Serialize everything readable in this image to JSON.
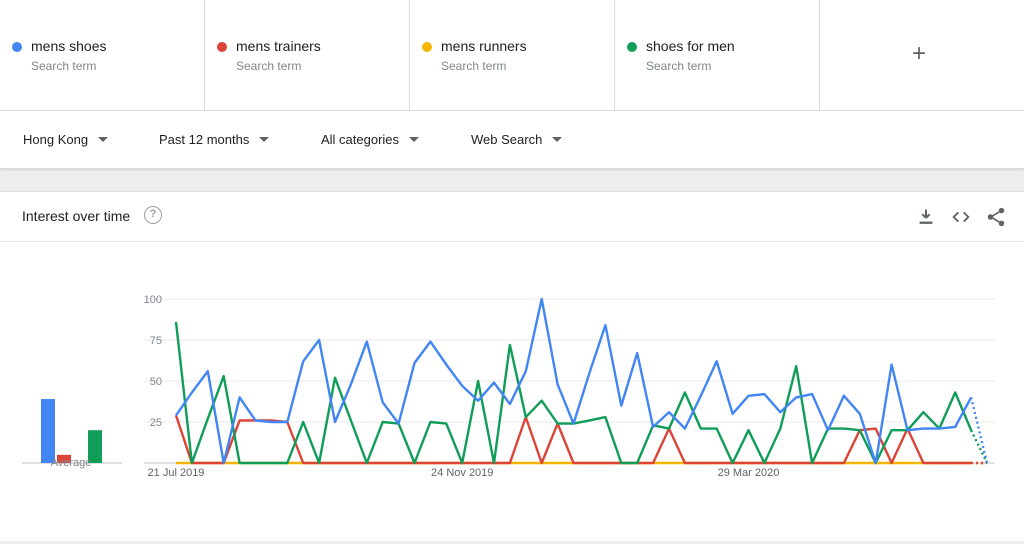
{
  "terms": [
    {
      "name": "mens shoes",
      "sub": "Search term",
      "color": "#4285f4"
    },
    {
      "name": "mens trainers",
      "sub": "Search term",
      "color": "#db4437"
    },
    {
      "name": "mens runners",
      "sub": "Search term",
      "color": "#f4b400"
    },
    {
      "name": "shoes for men",
      "sub": "Search term",
      "color": "#0f9d58"
    }
  ],
  "add_term_symbol": "+",
  "filters": {
    "region": "Hong Kong",
    "period": "Past 12 months",
    "category": "All categories",
    "search_type": "Web Search"
  },
  "card": {
    "title": "Interest over time",
    "help_symbol": "?"
  },
  "icons": [
    "help-icon",
    "download-icon",
    "embed-icon",
    "share-icon"
  ],
  "chart_data": {
    "type": "line",
    "ylim": [
      0,
      100
    ],
    "yticks": [
      25,
      50,
      75,
      100
    ],
    "x": [
      0,
      1,
      2,
      3,
      4,
      5,
      6,
      7,
      8,
      9,
      10,
      11,
      12,
      13,
      14,
      15,
      16,
      17,
      18,
      19,
      20,
      21,
      22,
      23,
      24,
      25,
      26,
      27,
      28,
      29,
      30,
      31,
      32,
      33,
      34,
      35,
      36,
      37,
      38,
      39,
      40,
      41,
      42,
      43,
      44,
      45,
      46,
      47,
      48,
      49,
      50,
      51
    ],
    "x_tick_labels": [
      {
        "index": 0,
        "label": "21 Jul 2019"
      },
      {
        "index": 18,
        "label": "24 Nov 2019"
      },
      {
        "index": 36,
        "label": "29 Mar 2020"
      }
    ],
    "series": [
      {
        "name": "mens shoes",
        "color": "#4285f4",
        "values": [
          29,
          43,
          56,
          0,
          40,
          26,
          25,
          25,
          62,
          75,
          25,
          48,
          74,
          37,
          24,
          61,
          74,
          60,
          47,
          38,
          49,
          36,
          56,
          100,
          48,
          24,
          55,
          84,
          35,
          67,
          22,
          31,
          21,
          41,
          62,
          30,
          41,
          42,
          31,
          40,
          42,
          20,
          41,
          30,
          0,
          60,
          20,
          21,
          21,
          22,
          40,
          0
        ],
        "partial_from": 50
      },
      {
        "name": "mens trainers",
        "color": "#db4437",
        "values": [
          29,
          0,
          0,
          0,
          26,
          26,
          26,
          25,
          0,
          0,
          0,
          0,
          0,
          0,
          0,
          0,
          0,
          0,
          0,
          0,
          0,
          0,
          28,
          0,
          24,
          0,
          0,
          0,
          0,
          0,
          0,
          21,
          0,
          0,
          0,
          0,
          0,
          0,
          0,
          0,
          0,
          0,
          0,
          20,
          21,
          0,
          21,
          0,
          0,
          0,
          0,
          0
        ],
        "partial_from": 50
      },
      {
        "name": "mens runners",
        "color": "#f4b400",
        "values": [
          0,
          0,
          0,
          0,
          0,
          0,
          0,
          0,
          0,
          0,
          0,
          0,
          0,
          0,
          0,
          0,
          0,
          0,
          0,
          0,
          0,
          0,
          0,
          0,
          0,
          0,
          0,
          0,
          0,
          0,
          0,
          0,
          0,
          0,
          0,
          0,
          0,
          0,
          0,
          0,
          0,
          0,
          0,
          0,
          0,
          0,
          0,
          0,
          0,
          0,
          0,
          0
        ],
        "partial_from": 50
      },
      {
        "name": "shoes for men",
        "color": "#0f9d58",
        "values": [
          86,
          0,
          27,
          53,
          0,
          0,
          0,
          0,
          25,
          0,
          52,
          26,
          0,
          25,
          24,
          0,
          25,
          24,
          0,
          50,
          0,
          72,
          28,
          38,
          24,
          24,
          26,
          28,
          0,
          0,
          23,
          21,
          43,
          21,
          21,
          0,
          20,
          0,
          21,
          59,
          0,
          21,
          21,
          20,
          0,
          20,
          20,
          31,
          21,
          43,
          20,
          0
        ],
        "partial_from": 50
      }
    ],
    "average": {
      "label": "Average",
      "values": [
        39,
        5,
        0,
        20
      ]
    }
  }
}
